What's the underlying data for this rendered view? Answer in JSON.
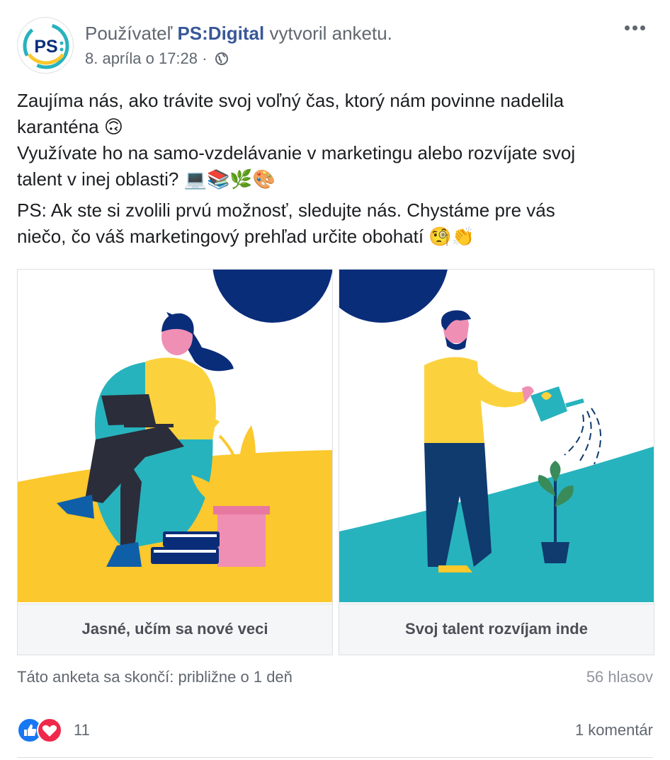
{
  "post": {
    "prefix": "Používateľ",
    "page_name": "PS:Digital",
    "action": "vytvoril anketu.",
    "timestamp": "8. apríla o 17:28",
    "separator": "·",
    "privacy_icon": "globe-icon",
    "avatar_text": "PS",
    "text": {
      "line1": "Zaujíma nás, ako trávite svoj voľný čas, ktorý nám povinne nadelila",
      "line2": "karanténa 🙃",
      "line3": "Využívate ho na samo-vzdelávanie v marketingu alebo rozvíjate svoj",
      "line4": "talent v inej oblasti? 💻📚🌿🎨",
      "line5": "PS: Ak ste si zvolili prvú možnosť, sledujte nás. Chystáme pre vás",
      "line6": "niečo, čo váš marketingový prehľad určite obohatí 🧐👏"
    }
  },
  "poll": {
    "options": [
      {
        "label": "Jasné, učím sa nové veci"
      },
      {
        "label": "Svoj talent rozvíjam inde"
      }
    ],
    "ends_text": "Táto anketa sa skončí: približne o 1 deň",
    "votes": "56 hlasov"
  },
  "engagement": {
    "reaction_count": "11",
    "comments": "1 komentár"
  },
  "colors": {
    "brand_blue": "#0a2d7a",
    "accent_yellow": "#fbc82d",
    "accent_teal": "#27b3bd",
    "link": "#385898"
  }
}
